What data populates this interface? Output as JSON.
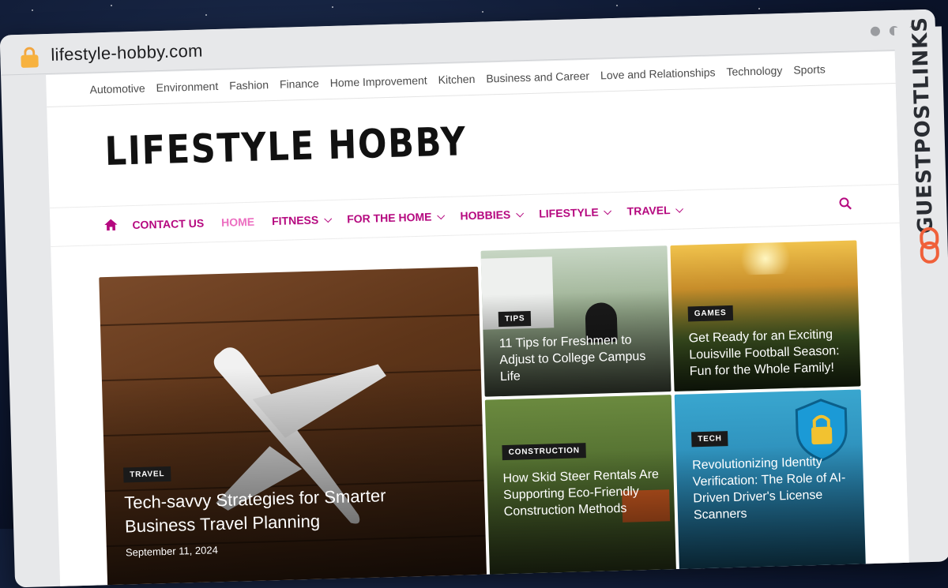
{
  "browser": {
    "url": "lifestyle-hobby.com"
  },
  "side_brand": {
    "text": "GUESTPOSTLINKS",
    "accent": "#f0603a"
  },
  "top_nav": {
    "items": [
      "Automotive",
      "Environment",
      "Fashion",
      "Finance",
      "Home Improvement",
      "Kitchen",
      "Business and Career",
      "Love and Relationships",
      "Technology",
      "Sports"
    ]
  },
  "site": {
    "logo": "LIFESTYLE HOBBY"
  },
  "main_nav": {
    "items": [
      {
        "label": "CONTACT US",
        "dropdown": false,
        "active": false
      },
      {
        "label": "HOME",
        "dropdown": false,
        "active": true
      },
      {
        "label": "FITNESS",
        "dropdown": true,
        "active": false
      },
      {
        "label": "FOR THE HOME",
        "dropdown": true,
        "active": false
      },
      {
        "label": "HOBBIES",
        "dropdown": true,
        "active": false
      },
      {
        "label": "LIFESTYLE",
        "dropdown": true,
        "active": false
      },
      {
        "label": "TRAVEL",
        "dropdown": true,
        "active": false
      }
    ],
    "accent": "#b5087f",
    "active_color": "#ec6fc1"
  },
  "posts": [
    {
      "tag": "TRAVEL",
      "title": "Tech-savvy Strategies for Smarter Business Travel Planning",
      "date": "September 11, 2024"
    },
    {
      "tag": "TIPS",
      "title": "11 Tips for Freshmen to Adjust to College Campus Life"
    },
    {
      "tag": "GAMES",
      "title": "Get Ready for an Exciting Louisville Football Season: Fun for the Whole Family!"
    },
    {
      "tag": "CONSTRUCTION",
      "title": "How Skid Steer Rentals Are Supporting Eco-Friendly Construction Methods"
    },
    {
      "tag": "TECH",
      "title": "Revolutionizing Identity Verification: The Role of AI-Driven Driver's License Scanners"
    }
  ]
}
